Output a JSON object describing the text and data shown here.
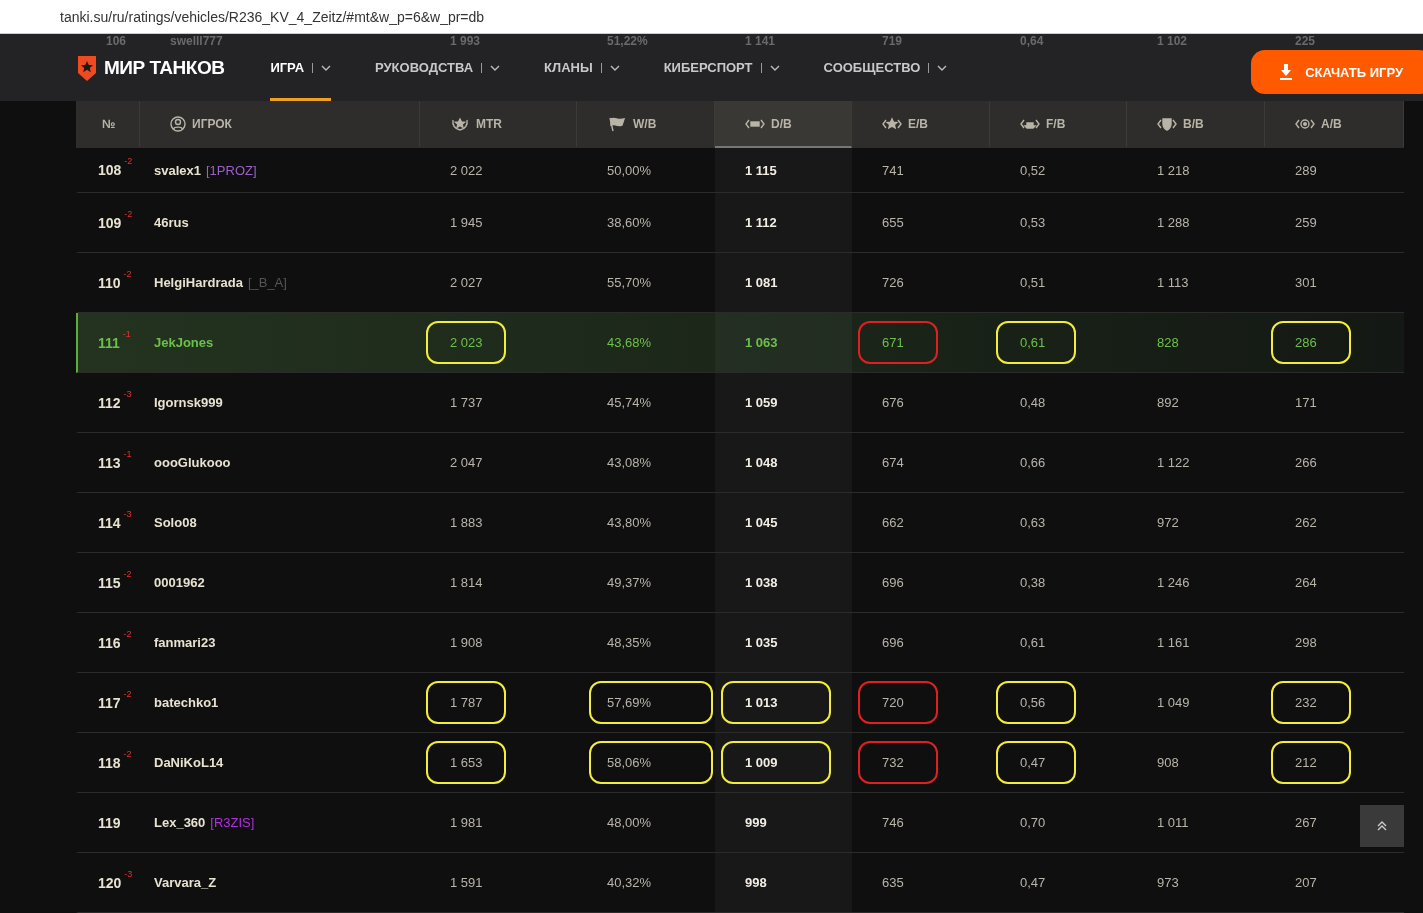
{
  "address_bar": {
    "url": "tanki.su/ru/ratings/vehicles/R236_KV_4_Zeitz/#mt&w_p=6&w_pr=db"
  },
  "nav": {
    "logo": "МИР ТАНКОВ",
    "items": [
      {
        "label": "ИГРА",
        "selected": true
      },
      {
        "label": "РУКОВОДСТВА",
        "selected": false
      },
      {
        "label": "КЛАНЫ",
        "selected": false
      },
      {
        "label": "КИБЕРСПОРТ",
        "selected": false
      },
      {
        "label": "СООБЩЕСТВО",
        "selected": false
      }
    ],
    "download_button": "СКАЧАТЬ ИГРУ",
    "behind_row": [
      "106",
      "swelll777",
      "1 993",
      "51,22%",
      "1 141",
      "719",
      "0,64",
      "1 102",
      "225"
    ]
  },
  "table": {
    "columns": [
      {
        "kind": "rank",
        "label": "№",
        "selected": false
      },
      {
        "kind": "player",
        "label": "ИГРОК",
        "selected": false
      },
      {
        "kind": "mtr",
        "label": "MTR",
        "selected": false
      },
      {
        "kind": "wins",
        "label": "W/B",
        "selected": false
      },
      {
        "kind": "damage",
        "label": "D/B",
        "selected": true
      },
      {
        "kind": "exp",
        "label": "E/B",
        "selected": false
      },
      {
        "kind": "frags",
        "label": "F/B",
        "selected": false
      },
      {
        "kind": "blocked",
        "label": "B/B",
        "selected": false
      },
      {
        "kind": "assist",
        "label": "A/B",
        "selected": false
      }
    ],
    "rows": [
      {
        "rank": "108",
        "delta": "-2",
        "player": "svalex1",
        "clan": {
          "text": "[1PROZ]",
          "color": "#9a5fc8"
        },
        "values": [
          {
            "text": "2 022"
          },
          {
            "text": "50,00%"
          },
          {
            "text": "1 115"
          },
          {
            "text": "741"
          },
          {
            "text": "0,52"
          },
          {
            "text": "1 218"
          },
          {
            "text": "289"
          }
        ],
        "selected": false
      },
      {
        "rank": "109",
        "delta": "-2",
        "player": "46rus",
        "values": [
          {
            "text": "1 945"
          },
          {
            "text": "38,60%"
          },
          {
            "text": "1 112"
          },
          {
            "text": "655"
          },
          {
            "text": "0,53"
          },
          {
            "text": "1 288"
          },
          {
            "text": "259"
          }
        ],
        "selected": false
      },
      {
        "rank": "110",
        "delta": "-2",
        "player": "HelgiHardrada",
        "clan": {
          "text": "[_B_A]",
          "color": "#555555"
        },
        "values": [
          {
            "text": "2 027"
          },
          {
            "text": "55,70%"
          },
          {
            "text": "1 081"
          },
          {
            "text": "726"
          },
          {
            "text": "0,51"
          },
          {
            "text": "1 113"
          },
          {
            "text": "301"
          }
        ],
        "selected": false
      },
      {
        "rank": "111",
        "delta": "-1",
        "player": "JekJones",
        "values": [
          {
            "text": "2 023",
            "color": "#f2ec3a"
          },
          {
            "text": "43,68%"
          },
          {
            "text": "1 063"
          },
          {
            "text": "671",
            "color": "#e02020"
          },
          {
            "text": "0,61",
            "color": "#f2ec3a"
          },
          {
            "text": "828"
          },
          {
            "text": "286",
            "color": "#f2ec3a"
          }
        ],
        "selected": true
      },
      {
        "rank": "112",
        "delta": "-3",
        "player": "Igornsk999",
        "values": [
          {
            "text": "1 737"
          },
          {
            "text": "45,74%"
          },
          {
            "text": "1 059"
          },
          {
            "text": "676"
          },
          {
            "text": "0,48"
          },
          {
            "text": "892"
          },
          {
            "text": "171"
          }
        ],
        "selected": false
      },
      {
        "rank": "113",
        "delta": "-1",
        "player": "oooGlukooo",
        "values": [
          {
            "text": "2 047"
          },
          {
            "text": "43,08%"
          },
          {
            "text": "1 048"
          },
          {
            "text": "674"
          },
          {
            "text": "0,66"
          },
          {
            "text": "1 122"
          },
          {
            "text": "266"
          }
        ],
        "selected": false
      },
      {
        "rank": "114",
        "delta": "-3",
        "player": "Solo08",
        "values": [
          {
            "text": "1 883"
          },
          {
            "text": "43,80%"
          },
          {
            "text": "1 045"
          },
          {
            "text": "662"
          },
          {
            "text": "0,63"
          },
          {
            "text": "972"
          },
          {
            "text": "262"
          }
        ],
        "selected": false
      },
      {
        "rank": "115",
        "delta": "-2",
        "player": "0001962",
        "values": [
          {
            "text": "1 814"
          },
          {
            "text": "49,37%"
          },
          {
            "text": "1 038"
          },
          {
            "text": "696"
          },
          {
            "text": "0,38"
          },
          {
            "text": "1 246"
          },
          {
            "text": "264"
          }
        ],
        "selected": false
      },
      {
        "rank": "116",
        "delta": "-2",
        "player": "fanmari23",
        "values": [
          {
            "text": "1 908"
          },
          {
            "text": "48,35%"
          },
          {
            "text": "1 035"
          },
          {
            "text": "696"
          },
          {
            "text": "0,61"
          },
          {
            "text": "1 161"
          },
          {
            "text": "298"
          }
        ],
        "selected": false
      },
      {
        "rank": "117",
        "delta": "-2",
        "player": "batechko1",
        "values": [
          {
            "text": "1 787",
            "color": "#f2ec3a"
          },
          {
            "text": "57,69%",
            "color": "#f2ec3a"
          },
          {
            "text": "1 013",
            "color": "#f2ec3a"
          },
          {
            "text": "720",
            "color": "#e02020"
          },
          {
            "text": "0,56",
            "color": "#f2ec3a"
          },
          {
            "text": "1 049"
          },
          {
            "text": "232",
            "color": "#f2ec3a"
          }
        ],
        "selected": false
      },
      {
        "rank": "118",
        "delta": "-2",
        "player": "DaNiKoL14",
        "values": [
          {
            "text": "1 653",
            "color": "#f2ec3a"
          },
          {
            "text": "58,06%",
            "color": "#f2ec3a"
          },
          {
            "text": "1 009",
            "color": "#f2ec3a"
          },
          {
            "text": "732",
            "color": "#e02020"
          },
          {
            "text": "0,47",
            "color": "#f2ec3a"
          },
          {
            "text": "908"
          },
          {
            "text": "212",
            "color": "#f2ec3a"
          }
        ],
        "selected": false
      },
      {
        "rank": "119",
        "player": "Lex_360",
        "clan": {
          "text": "[R3ZIS]",
          "color": "#b030e0"
        },
        "values": [
          {
            "text": "1 981"
          },
          {
            "text": "48,00%"
          },
          {
            "text": "999"
          },
          {
            "text": "746"
          },
          {
            "text": "0,70"
          },
          {
            "text": "1 011"
          },
          {
            "text": "267"
          }
        ],
        "selected": false
      },
      {
        "rank": "120",
        "delta": "-3",
        "player": "Varvara_Z",
        "values": [
          {
            "text": "1 591"
          },
          {
            "text": "40,32%"
          },
          {
            "text": "998"
          },
          {
            "text": "635"
          },
          {
            "text": "0,47"
          },
          {
            "text": "973"
          },
          {
            "text": "207"
          }
        ],
        "selected": false
      }
    ]
  }
}
